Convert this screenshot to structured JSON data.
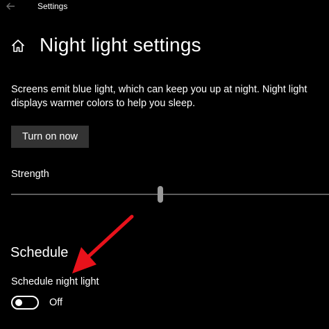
{
  "window": {
    "title": "Settings"
  },
  "icons": {
    "back": "back-arrow-icon",
    "home": "home-icon"
  },
  "header": {
    "title": "Night light settings"
  },
  "description": "Screens emit blue light, which can keep you up at night. Night light displays warmer colors to help you sleep.",
  "turn_on_button": {
    "label": "Turn on now"
  },
  "strength": {
    "label": "Strength",
    "value_fraction": 0.47
  },
  "schedule": {
    "heading": "Schedule",
    "toggle_label": "Schedule night light",
    "toggle_state": "Off",
    "toggle_on": false
  },
  "colors": {
    "background": "#000000",
    "text": "#ffffff",
    "button_bg": "#333333",
    "slider_track": "#5d5d5d",
    "slider_thumb": "#9a9a9a",
    "annotation_arrow": "#e8121b"
  }
}
